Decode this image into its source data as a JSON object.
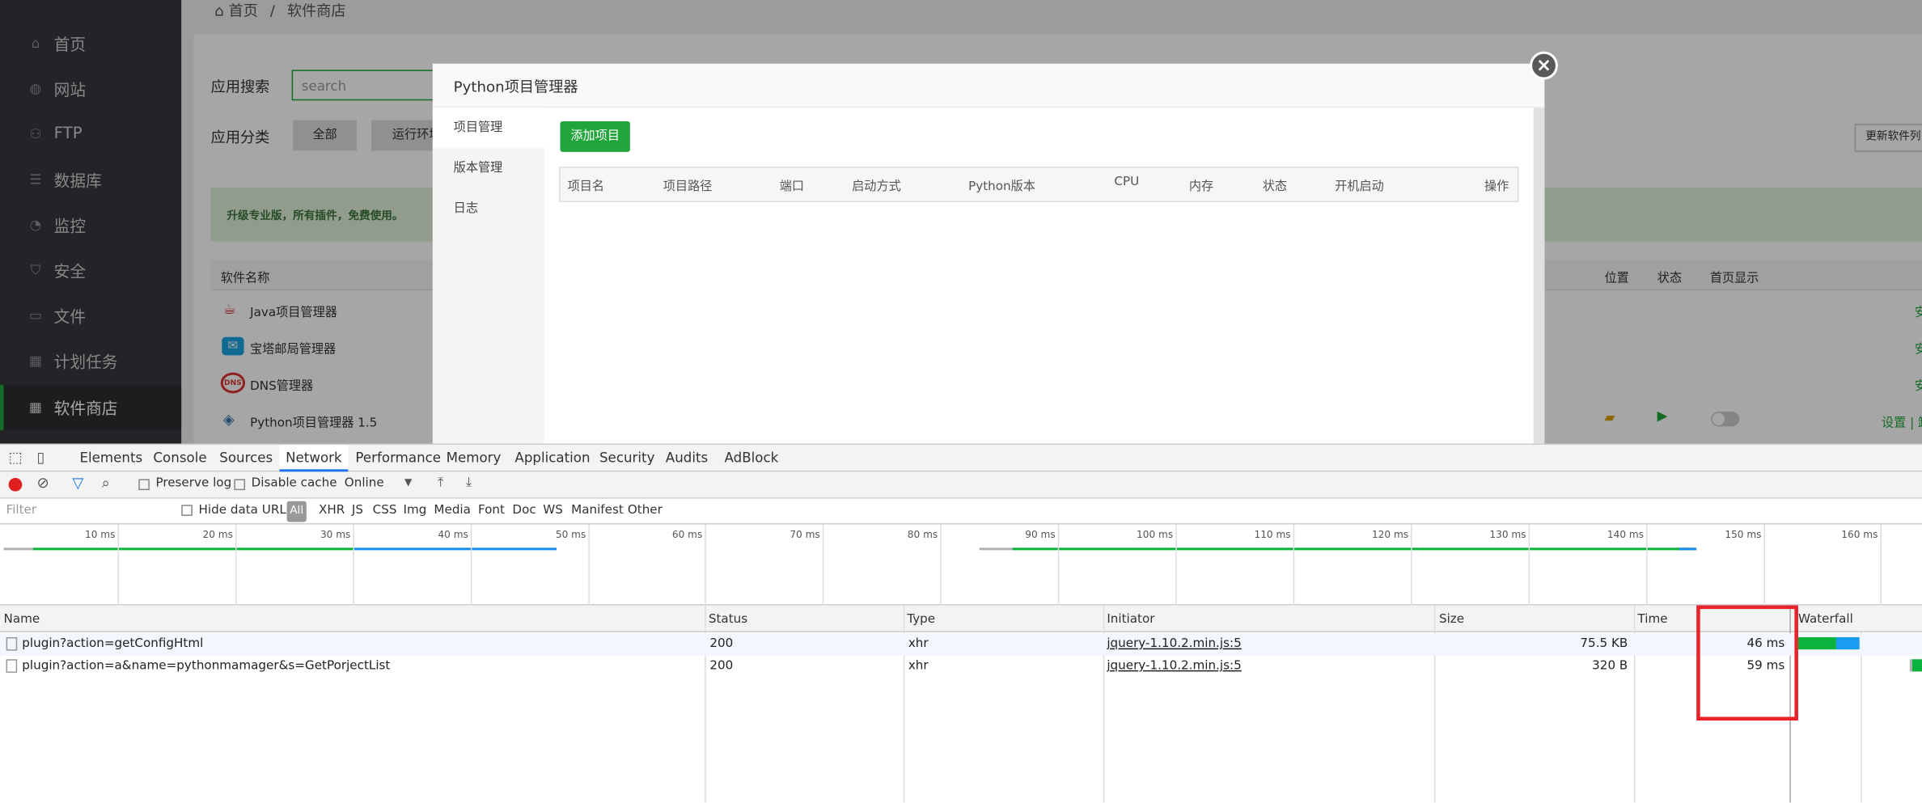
{
  "sidebar": {
    "items": [
      {
        "label": "首页",
        "icon": "home-icon"
      },
      {
        "label": "网站",
        "icon": "globe-icon"
      },
      {
        "label": "FTP",
        "icon": "ftp-icon"
      },
      {
        "label": "数据库",
        "icon": "database-icon"
      },
      {
        "label": "监控",
        "icon": "monitor-icon"
      },
      {
        "label": "安全",
        "icon": "shield-icon"
      },
      {
        "label": "文件",
        "icon": "folder-icon"
      },
      {
        "label": "计划任务",
        "icon": "calendar-icon"
      },
      {
        "label": "软件商店",
        "icon": "grid-icon"
      }
    ]
  },
  "breadcrumb": {
    "home": "首页",
    "sep": "/",
    "current": "软件商店"
  },
  "store": {
    "search_label": "应用搜索",
    "search_placeholder": "search",
    "category_label": "应用分类",
    "cat_all": "全部",
    "cat_runtime": "运行环境",
    "update_btn": "更新软件列",
    "banner": "升级专业版，所有插件，免费使用。",
    "col_name": "软件名称",
    "col_location": "位置",
    "col_status": "状态",
    "col_home": "首页显示",
    "rows": [
      {
        "name": "Java项目管理器",
        "action": "安"
      },
      {
        "name": "宝塔邮局管理器",
        "action": "安"
      },
      {
        "name": "DNS管理器",
        "action": "安"
      },
      {
        "name": "Python项目管理器 1.5",
        "action": "设置 | 卸"
      }
    ]
  },
  "modal": {
    "title": "Python项目管理器",
    "tabs": [
      "项目管理",
      "版本管理",
      "日志"
    ],
    "add_btn": "添加项目",
    "columns": [
      "项目名",
      "项目路径",
      "端口",
      "启动方式",
      "Python版本",
      "CPU",
      "内存",
      "状态",
      "开机启动",
      "操作"
    ]
  },
  "devtools": {
    "tabs": [
      "Elements",
      "Console",
      "Sources",
      "Network",
      "Performance",
      "Memory",
      "Application",
      "Security",
      "Audits",
      "AdBlock"
    ],
    "active_tab": "Network",
    "preserve_log": "Preserve log",
    "disable_cache": "Disable cache",
    "throttle": "Online",
    "filter_placeholder": "Filter",
    "hide_data_urls": "Hide data URLs",
    "types": [
      "All",
      "XHR",
      "JS",
      "CSS",
      "Img",
      "Media",
      "Font",
      "Doc",
      "WS",
      "Manifest",
      "Other"
    ],
    "timeline_ticks": [
      "10 ms",
      "20 ms",
      "30 ms",
      "40 ms",
      "50 ms",
      "60 ms",
      "70 ms",
      "80 ms",
      "90 ms",
      "100 ms",
      "110 ms",
      "120 ms",
      "130 ms",
      "140 ms",
      "150 ms",
      "160 ms"
    ],
    "columns": {
      "name": "Name",
      "status": "Status",
      "type": "Type",
      "initiator": "Initiator",
      "size": "Size",
      "time": "Time",
      "waterfall": "Waterfall"
    },
    "requests": [
      {
        "name": "plugin?action=getConfigHtml",
        "status": "200",
        "type": "xhr",
        "initiator": "jquery-1.10.2.min.js:5",
        "size": "75.5 KB",
        "time": "46 ms"
      },
      {
        "name": "plugin?action=a&name=pythonmamager&s=GetPorjectList",
        "status": "200",
        "type": "xhr",
        "initiator": "jquery-1.10.2.min.js:5",
        "size": "320 B",
        "time": "59 ms"
      }
    ]
  },
  "colors": {
    "brand_green": "#20a53a",
    "highlight_red": "#e8232a",
    "sidebar_bg": "#35383d"
  }
}
